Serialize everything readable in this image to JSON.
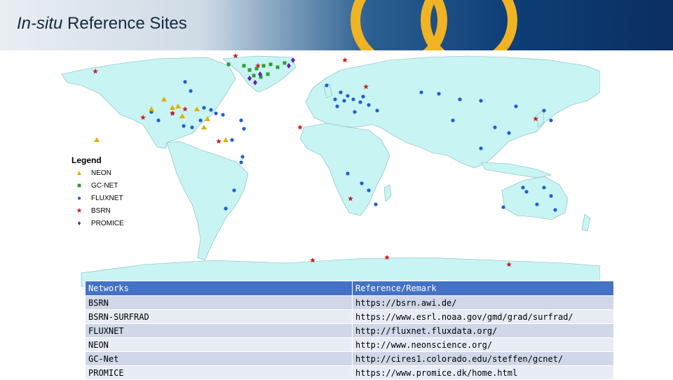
{
  "title": {
    "italic": "In-situ",
    "rest": " Reference Sites"
  },
  "legend": {
    "title": "Legend",
    "items": [
      {
        "label": "NEON",
        "symbol": "▲",
        "color": "#e0b000"
      },
      {
        "label": "GC-NET",
        "symbol": "■",
        "color": "#2ea02e"
      },
      {
        "label": "FLUXNET",
        "symbol": "●",
        "color": "#1f5fd6"
      },
      {
        "label": "BSRN",
        "symbol": "★",
        "color": "#d02020"
      },
      {
        "label": "PROMICE",
        "symbol": "♦",
        "color": "#6a1fa8"
      }
    ]
  },
  "table": {
    "headers": [
      "Networks",
      "Reference/Remark"
    ],
    "rows": [
      [
        "BSRN",
        "https://bsrn.awi.de/"
      ],
      [
        "BSRN-SURFRAD",
        "https://www.esrl.noaa.gov/gmd/grad/surfrad/"
      ],
      [
        "FLUXNET",
        "http://fluxnet.fluxdata.org/"
      ],
      [
        "NEON",
        "http://www.neonscience.org/"
      ],
      [
        "GC-Net",
        "http://cires1.colorado.edu/steffen/gcnet/"
      ],
      [
        "PROMICE",
        "https://www.promice.dk/home.html"
      ]
    ]
  },
  "colors": {
    "land": "#c8f4f4",
    "header_bg": "#4472c4",
    "row_odd": "#cfd7e8",
    "row_even": "#e8ecf5"
  }
}
